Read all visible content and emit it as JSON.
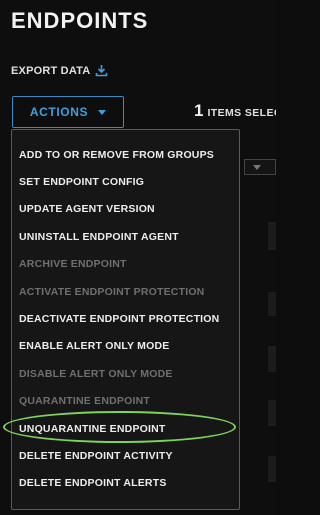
{
  "header": {
    "title": "ENDPOINTS",
    "export_label": "EXPORT DATA"
  },
  "toolbar": {
    "actions_label": "ACTIONS",
    "items_count": "1",
    "items_label": "ITEMS SELEC"
  },
  "menu": {
    "items": [
      {
        "label": "ADD TO OR REMOVE FROM GROUPS",
        "enabled": true
      },
      {
        "label": "SET ENDPOINT CONFIG",
        "enabled": true
      },
      {
        "label": "UPDATE AGENT VERSION",
        "enabled": true
      },
      {
        "label": "UNINSTALL ENDPOINT AGENT",
        "enabled": true
      },
      {
        "label": "ARCHIVE ENDPOINT",
        "enabled": false
      },
      {
        "label": "ACTIVATE ENDPOINT PROTECTION",
        "enabled": false
      },
      {
        "label": "DEACTIVATE ENDPOINT PROTECTION",
        "enabled": true
      },
      {
        "label": "ENABLE ALERT ONLY MODE",
        "enabled": true
      },
      {
        "label": "DISABLE ALERT ONLY MODE",
        "enabled": false
      },
      {
        "label": "QUARANTINE ENDPOINT",
        "enabled": false
      },
      {
        "label": "UNQUARANTINE ENDPOINT",
        "enabled": true
      },
      {
        "label": "DELETE ENDPOINT ACTIVITY",
        "enabled": true
      },
      {
        "label": "DELETE ENDPOINT ALERTS",
        "enabled": true
      }
    ],
    "highlighted_item": "UNQUARANTINE ENDPOINT"
  },
  "colors": {
    "accent": "#3fa0de",
    "highlight": "#7ed35a",
    "disabled": "#6f6f6f"
  }
}
